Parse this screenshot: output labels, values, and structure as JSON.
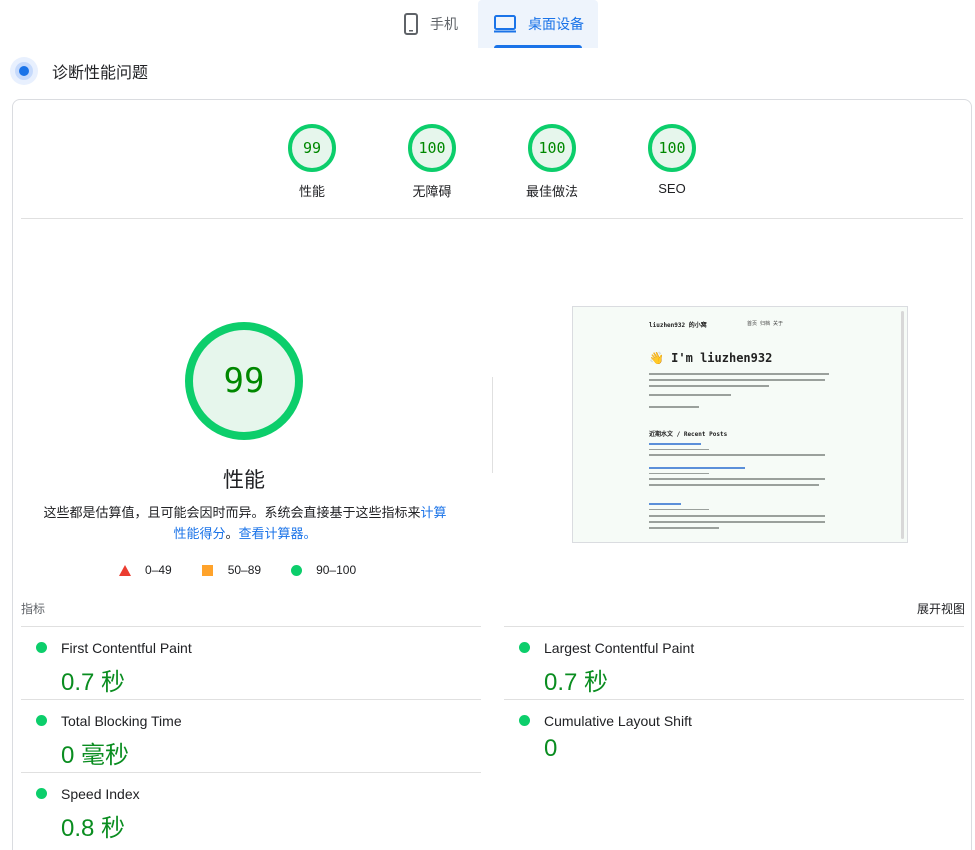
{
  "tabs": {
    "mobile": "手机",
    "desktop": "桌面设备"
  },
  "diagnose": {
    "title": "诊断性能问题"
  },
  "scores": [
    {
      "value": "99",
      "label": "性能"
    },
    {
      "value": "100",
      "label": "无障碍"
    },
    {
      "value": "100",
      "label": "最佳做法"
    },
    {
      "value": "100",
      "label": "SEO"
    }
  ],
  "performance": {
    "score": "99",
    "title": "性能",
    "desc_prefix": "这些都是估算值，且可能会因时而异。系统会直接基于这些指标来",
    "desc_link1": "计算性能得分",
    "desc_sep": "。",
    "desc_link2": "查看计算器。"
  },
  "legend": {
    "fail": "0–49",
    "average": "50–89",
    "pass": "90–100"
  },
  "thumbnail": {
    "site": "liuzhen932 的小窝",
    "nav": "首页  归档  关于",
    "hello": "👋 I'm liuzhen932",
    "recent": "近期水文 / Recent Posts"
  },
  "metrics": {
    "header": "指标",
    "expand": "展开视图",
    "items": [
      {
        "name": "First Contentful Paint",
        "value": "0.7 秒"
      },
      {
        "name": "Largest Contentful Paint",
        "value": "0.7 秒"
      },
      {
        "name": "Total Blocking Time",
        "value": "0 毫秒"
      },
      {
        "name": "Cumulative Layout Shift",
        "value": "0"
      },
      {
        "name": "Speed Index",
        "value": "0.8 秒"
      }
    ]
  },
  "colors": {
    "pass": "#0cce6b",
    "average": "#ffa32b",
    "fail": "#eb3c30",
    "accent": "#1a73e8",
    "value_text": "#0a8d20"
  }
}
